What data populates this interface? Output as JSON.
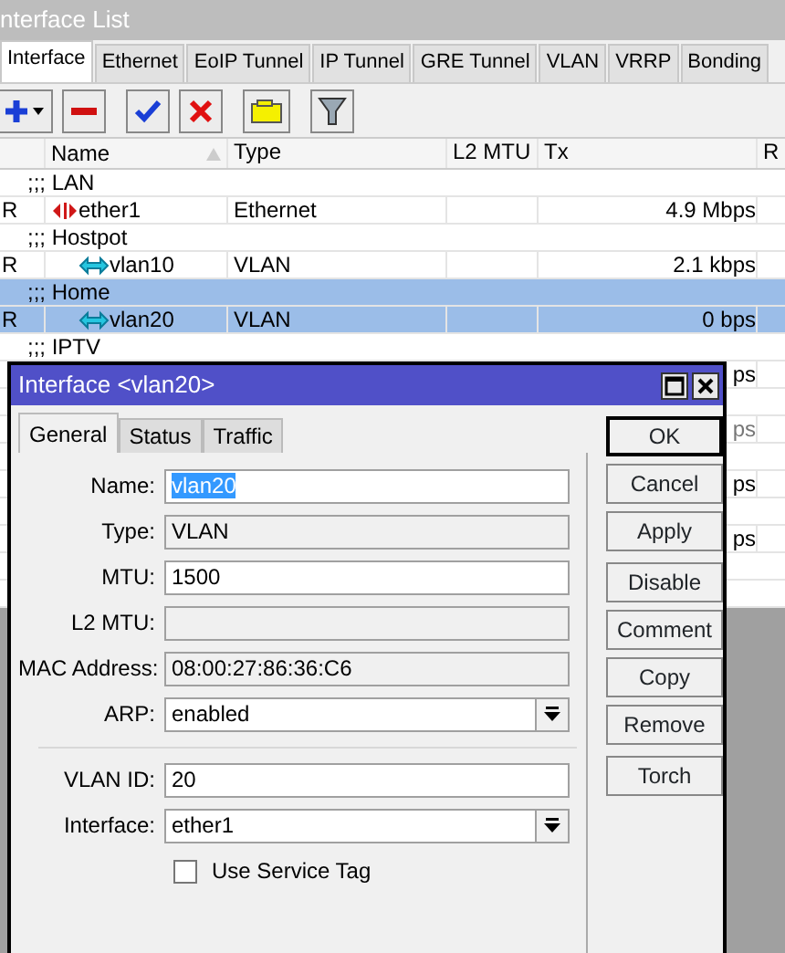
{
  "window": {
    "title": "nterface List"
  },
  "tabs": [
    {
      "label": "Interface",
      "selected": true
    },
    {
      "label": "Ethernet",
      "selected": false
    },
    {
      "label": "EoIP Tunnel",
      "selected": false
    },
    {
      "label": "IP Tunnel",
      "selected": false
    },
    {
      "label": "GRE Tunnel",
      "selected": false
    },
    {
      "label": "VLAN",
      "selected": false
    },
    {
      "label": "VRRP",
      "selected": false
    },
    {
      "label": "Bonding",
      "selected": false
    }
  ],
  "toolbar": [
    {
      "kind": "add"
    },
    {
      "kind": "remove"
    },
    {
      "kind": "enable"
    },
    {
      "kind": "disable"
    },
    {
      "kind": "comment"
    },
    {
      "kind": "filter"
    }
  ],
  "table": {
    "columns": [
      {
        "label": "Name",
        "sorted": true
      },
      {
        "label": "Type",
        "sorted": false
      },
      {
        "label": "L2 MTU",
        "sorted": false
      },
      {
        "label": "Tx",
        "sorted": false
      },
      {
        "label": "R",
        "sorted": false
      }
    ],
    "rows": [
      {
        "kind": "comment",
        "text": ";;; LAN",
        "selected": false
      },
      {
        "kind": "ethernet",
        "flag": "R",
        "name": "ether1",
        "type": "Ethernet",
        "tx": "4.9 Mbps",
        "selected": false,
        "disabled": false
      },
      {
        "kind": "comment",
        "text": ";;; Hostpot",
        "selected": false
      },
      {
        "kind": "vlan",
        "flag": "R",
        "name": "vlan10",
        "type": "VLAN",
        "tx": "2.1 kbps",
        "selected": false,
        "disabled": false
      },
      {
        "kind": "comment",
        "text": ";;; Home",
        "selected": true
      },
      {
        "kind": "vlan",
        "flag": "R",
        "name": "vlan20",
        "type": "VLAN",
        "tx": "0 bps",
        "selected": true,
        "disabled": false
      },
      {
        "kind": "comment",
        "text": ";;; IPTV",
        "selected": false
      },
      {
        "kind": "interface",
        "tx": "ps",
        "selected": false,
        "disabled": false
      },
      {
        "kind": "comment",
        "selected": false
      },
      {
        "kind": "interface",
        "tx": "ps",
        "selected": false,
        "disabled": true
      },
      {
        "kind": "comment",
        "selected": false
      },
      {
        "kind": "interface",
        "tx": "ps",
        "selected": false,
        "disabled": false
      },
      {
        "kind": "comment",
        "selected": false
      },
      {
        "kind": "interface",
        "tx": "ps",
        "selected": false,
        "disabled": false
      },
      {
        "kind": "comment",
        "selected": false
      },
      {
        "kind": "comment",
        "selected": false
      }
    ]
  },
  "dialog": {
    "title": "Interface <vlan20>",
    "tabs": [
      {
        "label": "General",
        "selected": true
      },
      {
        "label": "Status",
        "selected": false
      },
      {
        "label": "Traffic",
        "selected": false
      }
    ],
    "fields": [
      {
        "kind": "text",
        "label": "Name:",
        "value": "vlan20",
        "highlighted": true
      },
      {
        "kind": "readonly",
        "label": "Type:",
        "value": "VLAN"
      },
      {
        "kind": "text",
        "label": "MTU:",
        "value": "1500",
        "highlighted": false
      },
      {
        "kind": "readonly",
        "label": "L2 MTU:"
      },
      {
        "kind": "readonly",
        "label": "MAC Address:",
        "value": "08:00:27:86:36:C6"
      },
      {
        "kind": "select",
        "label": "ARP:",
        "value": "enabled"
      },
      {
        "kind": "divider"
      },
      {
        "kind": "text",
        "label": "VLAN ID:",
        "value": "20",
        "highlighted": false
      },
      {
        "kind": "select",
        "label": "Interface:",
        "value": "ether1"
      },
      {
        "kind": "checkbox",
        "label": "Use Service Tag",
        "checked": false
      }
    ],
    "button_groups": [
      [
        {
          "label": "OK",
          "default": true
        },
        {
          "label": "Cancel",
          "default": false
        },
        {
          "label": "Apply",
          "default": false
        }
      ],
      [
        {
          "label": "Disable",
          "default": false
        },
        {
          "label": "Comment",
          "default": false
        },
        {
          "label": "Copy",
          "default": false
        },
        {
          "label": "Remove",
          "default": false
        }
      ],
      [
        {
          "label": "Torch",
          "default": false
        }
      ]
    ]
  }
}
